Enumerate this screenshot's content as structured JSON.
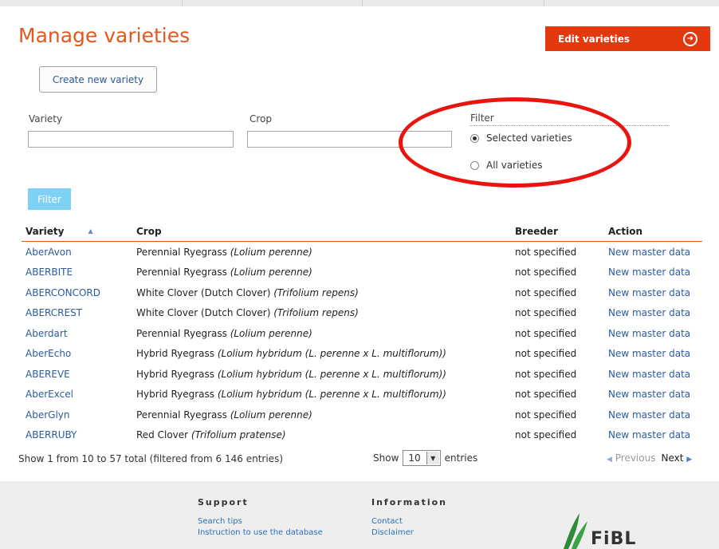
{
  "header": {
    "title": "Manage varieties",
    "edit_button": "Edit varieties",
    "create_button": "Create new variety"
  },
  "filters": {
    "variety_label": "Variety",
    "variety_value": "",
    "crop_label": "Crop",
    "crop_value": "",
    "filter_label": "Filter",
    "options": [
      "Selected varieties",
      "All varieties"
    ],
    "selected_option": "Selected varieties",
    "filter_button": "Filter"
  },
  "table": {
    "columns": [
      "Variety",
      "Crop",
      "Breeder",
      "Action"
    ],
    "rows": [
      {
        "variety": "AberAvon",
        "crop": "Perennial Ryegrass ",
        "latin": "(Lolium perenne)",
        "breeder": "not specified",
        "action": "New master data"
      },
      {
        "variety": "ABERBITE",
        "crop": "Perennial Ryegrass ",
        "latin": "(Lolium perenne)",
        "breeder": "not specified",
        "action": "New master data"
      },
      {
        "variety": "ABERCONCORD",
        "crop": "White Clover (Dutch Clover) ",
        "latin": "(Trifolium repens)",
        "breeder": "not specified",
        "action": "New master data"
      },
      {
        "variety": "ABERCREST",
        "crop": "White Clover (Dutch Clover) ",
        "latin": "(Trifolium repens)",
        "breeder": "not specified",
        "action": "New master data"
      },
      {
        "variety": "Aberdart",
        "crop": "Perennial Ryegrass ",
        "latin": "(Lolium perenne)",
        "breeder": "not specified",
        "action": "New master data"
      },
      {
        "variety": "AberEcho",
        "crop": "Hybrid Ryegrass ",
        "latin": "(Lolium hybridum (L. perenne x L. multiflorum))",
        "breeder": "not specified",
        "action": "New master data"
      },
      {
        "variety": "ABEREVE",
        "crop": "Hybrid Ryegrass ",
        "latin": "(Lolium hybridum (L. perenne x L. multiflorum))",
        "breeder": "not specified",
        "action": "New master data"
      },
      {
        "variety": "AberExcel",
        "crop": "Hybrid Ryegrass ",
        "latin": "(Lolium hybridum (L. perenne x L. multiflorum))",
        "breeder": "not specified",
        "action": "New master data"
      },
      {
        "variety": "AberGlyn",
        "crop": "Perennial Ryegrass ",
        "latin": "(Lolium perenne)",
        "breeder": "not specified",
        "action": "New master data"
      },
      {
        "variety": "ABERRUBY",
        "crop": "Red Clover ",
        "latin": "(Trifolium pratense)",
        "breeder": "not specified",
        "action": "New master data"
      }
    ]
  },
  "pagination": {
    "info": "Show 1 from 10 to 57 total (filtered from 6 146 entries)",
    "show_label": "Show",
    "page_size": "10",
    "entries_label": "entries",
    "previous": "Previous",
    "next": "Next"
  },
  "footer": {
    "support_heading": "Support",
    "support_links": [
      "Search tips",
      "Instruction to use the database"
    ],
    "info_heading": "Information",
    "info_links": [
      "Contact",
      "Disclaimer"
    ],
    "logo_text": "FiBL"
  },
  "colors": {
    "accent": "#e05a1f",
    "edit_button": "#e4390f",
    "link": "#2b5aa0",
    "filter_button": "#7fd0f5",
    "highlight_ellipse": "#e8140d"
  }
}
